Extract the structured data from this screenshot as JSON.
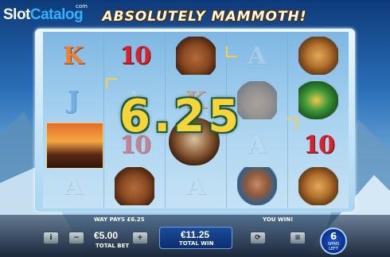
{
  "logo": {
    "part1": "Slot",
    "part2": "Catalog",
    "suffix": "com"
  },
  "game_title": "ABSOLUTELY MAMMOTH!",
  "win_amount_display": "6.25",
  "reels": [
    [
      "K",
      "J",
      "volcano",
      "A"
    ],
    [
      "10",
      "A",
      "10",
      "bear"
    ],
    [
      "bear",
      "K",
      "mammoth",
      "A"
    ],
    [
      "A",
      "bear",
      "A",
      "woman"
    ],
    [
      "tiger",
      "eagle",
      "10",
      "tiger"
    ]
  ],
  "status": {
    "way_pays": "WAY PAYS £6.25",
    "you_win": "YOU WIN!"
  },
  "total_bet": {
    "value": "€5.00",
    "label": "TOTAL BET"
  },
  "total_win": {
    "value": "€11.25",
    "label": "TOTAL WIN"
  },
  "spins": {
    "count": "6",
    "label1": "SPINS",
    "label2": "LEFT"
  },
  "icons": [
    "info-icon",
    "minus-icon",
    "plus-icon",
    "autoplay-icon",
    "settings-icon"
  ],
  "colors": {
    "win_gold": "#f6d43a",
    "accent_blue": "#1b4b9a"
  }
}
